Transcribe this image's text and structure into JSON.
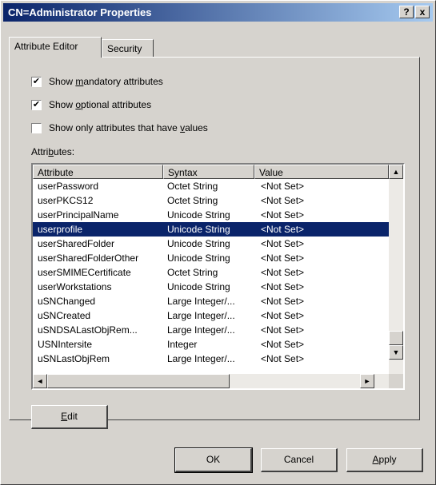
{
  "window": {
    "title": "CN=Administrator Properties",
    "help_label": "?",
    "close_label": "x"
  },
  "tabs": [
    {
      "label": "Attribute Editor",
      "active": true
    },
    {
      "label": "Security",
      "active": false
    }
  ],
  "checkboxes": [
    {
      "pre": "Show ",
      "mnemonic": "m",
      "post": "andatory attributes",
      "checked": true
    },
    {
      "pre": "Show ",
      "mnemonic": "o",
      "post": "ptional attributes",
      "checked": true
    },
    {
      "pre": "Show only attributes that have ",
      "mnemonic": "v",
      "post": "alues",
      "checked": false
    }
  ],
  "attributes_label": {
    "pre": "Attri",
    "mnemonic": "b",
    "post": "utes:"
  },
  "list": {
    "columns": [
      "Attribute",
      "Syntax",
      "Value"
    ],
    "rows": [
      {
        "attribute": "userPassword",
        "syntax": "Octet String",
        "value": "<Not Set>"
      },
      {
        "attribute": "userPKCS12",
        "syntax": "Octet String",
        "value": "<Not Set>"
      },
      {
        "attribute": "userPrincipalName",
        "syntax": "Unicode String",
        "value": "<Not Set>"
      },
      {
        "attribute": "userprofile",
        "syntax": "Unicode String",
        "value": "<Not Set>",
        "selected": true
      },
      {
        "attribute": "userSharedFolder",
        "syntax": "Unicode String",
        "value": "<Not Set>"
      },
      {
        "attribute": "userSharedFolderOther",
        "syntax": "Unicode String",
        "value": "<Not Set>"
      },
      {
        "attribute": "userSMIMECertificate",
        "syntax": "Octet String",
        "value": "<Not Set>"
      },
      {
        "attribute": "userWorkstations",
        "syntax": "Unicode String",
        "value": "<Not Set>"
      },
      {
        "attribute": "uSNChanged",
        "syntax": "Large Integer/...",
        "value": "<Not Set>"
      },
      {
        "attribute": "uSNCreated",
        "syntax": "Large Integer/...",
        "value": "<Not Set>"
      },
      {
        "attribute": "uSNDSALastObjRem...",
        "syntax": "Large Integer/...",
        "value": "<Not Set>"
      },
      {
        "attribute": "USNIntersite",
        "syntax": "Integer",
        "value": "<Not Set>"
      },
      {
        "attribute": "uSNLastObjRem",
        "syntax": "Large Integer/...",
        "value": "<Not Set>"
      }
    ],
    "scroll_up": "▲",
    "scroll_down": "▼",
    "scroll_left": "◄",
    "scroll_right": "►"
  },
  "edit_button": {
    "mnemonic": "E",
    "post": "dit"
  },
  "footer": {
    "ok_label": "OK",
    "cancel_label": "Cancel",
    "apply_mnemonic": "A",
    "apply_post": "pply"
  },
  "colors": {
    "titlebar_start": "#0a246a",
    "titlebar_end": "#a6caf0",
    "selection": "#0a246a",
    "face": "#d6d3ce"
  }
}
